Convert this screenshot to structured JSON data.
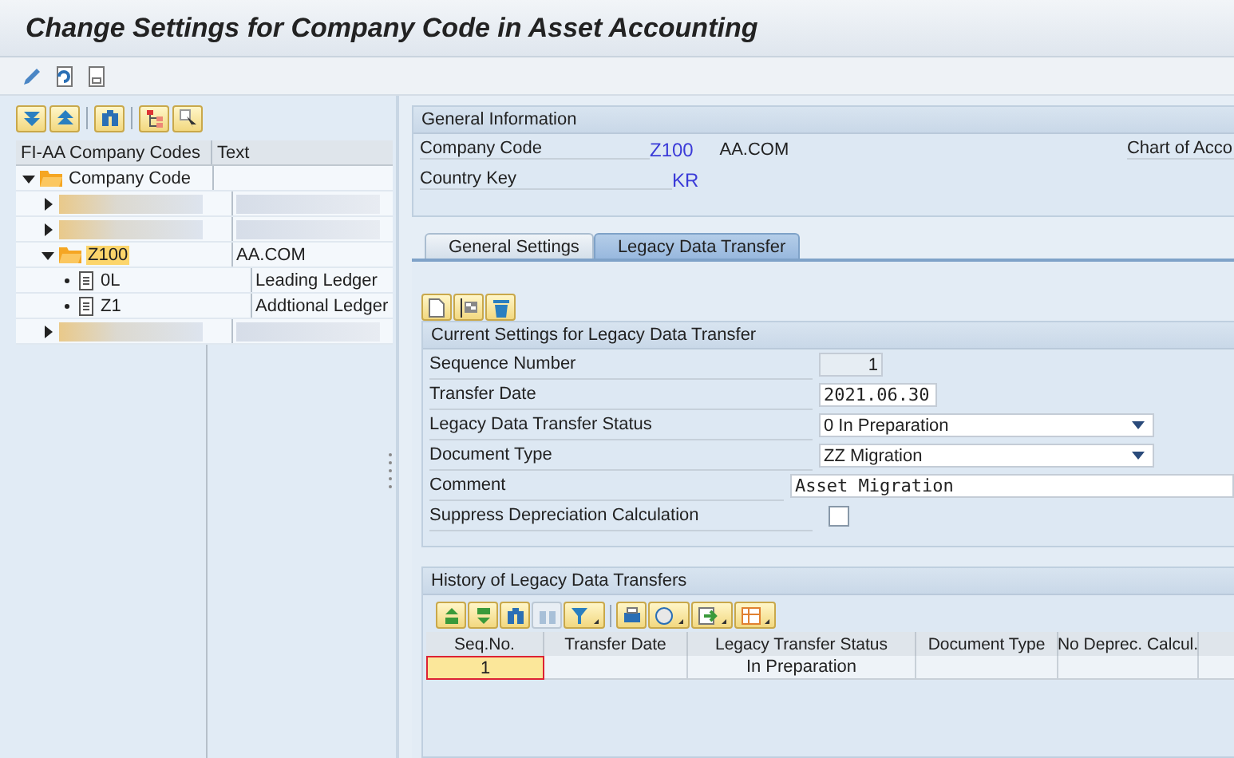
{
  "window": {
    "title": "Change Settings for Company Code in Asset Accounting"
  },
  "tree": {
    "columns": [
      "FI-AA Company Codes",
      "Text"
    ],
    "nodes": [
      {
        "kind": "folder",
        "label": "Company Code",
        "expanded": true,
        "selected": false,
        "children": [
          {
            "kind": "blurred",
            "expanded": false
          },
          {
            "kind": "blurred",
            "expanded": false
          },
          {
            "kind": "folder",
            "label": "Z100",
            "text": "AA.COM",
            "expanded": true,
            "selected": true,
            "children": [
              {
                "kind": "document",
                "label": "0L",
                "text": "Leading Ledger",
                "selected": false
              },
              {
                "kind": "document",
                "label": "Z1",
                "text": "Addtional Ledger",
                "selected": false
              }
            ]
          },
          {
            "kind": "blurred",
            "expanded": false
          }
        ]
      }
    ]
  },
  "general_info": {
    "title": "General Information",
    "fields": [
      {
        "label": "Company Code",
        "value": "Z100",
        "text": "AA.COM"
      },
      {
        "label": "Country Key",
        "value": "KR"
      }
    ],
    "cut_label": "Chart of Acco"
  },
  "tabs": [
    {
      "label": "General Settings",
      "selected": false
    },
    {
      "label": "Legacy Data Transfer",
      "selected": true
    }
  ],
  "current": {
    "title": "Current Settings for Legacy Data Transfer",
    "fields": [
      {
        "kind": "readonly",
        "label": "Sequence Number",
        "value": "1"
      },
      {
        "kind": "date",
        "label": "Transfer Date",
        "value": "2021.06.30"
      },
      {
        "kind": "dropdown",
        "label": "Legacy Data Transfer Status",
        "value": "0 In Preparation"
      },
      {
        "kind": "dropdown",
        "label": "Document Type",
        "value": "ZZ Migration"
      },
      {
        "kind": "text",
        "label": "Comment",
        "value": "Asset Migration"
      },
      {
        "kind": "checkbox",
        "label": "Suppress Depreciation Calculation",
        "checked": false
      }
    ]
  },
  "history": {
    "title": "History of Legacy Data Transfers",
    "columns": [
      "Seq.No.",
      "Transfer Date",
      "Legacy Transfer Status",
      "Document Type",
      "No Deprec. Calcul."
    ],
    "rows": [
      {
        "seq_no": "1",
        "legacy_transfer_status": "In Preparation",
        "selected": true
      }
    ]
  }
}
